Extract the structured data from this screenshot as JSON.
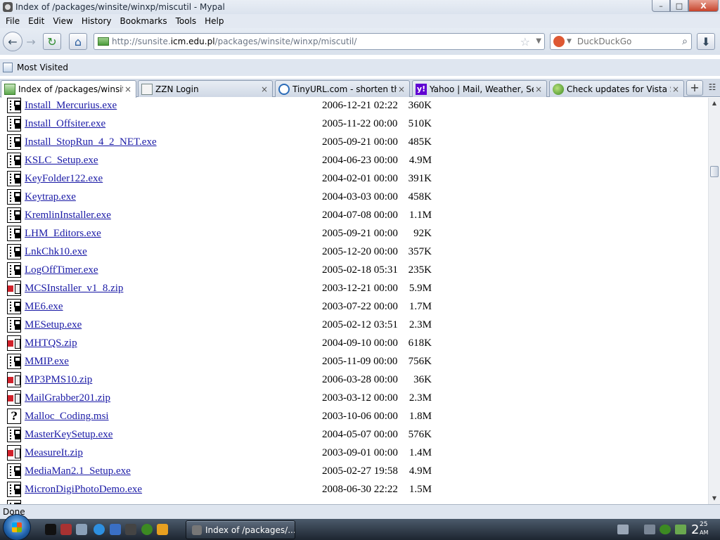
{
  "window": {
    "title": "Index of /packages/winsite/winxp/miscutil - Mypal",
    "minimize": "–",
    "maximize": "□",
    "close": "X"
  },
  "menu": [
    "File",
    "Edit",
    "View",
    "History",
    "Bookmarks",
    "Tools",
    "Help"
  ],
  "nav": {
    "back_icon": "←",
    "forward_icon": "→",
    "reload_icon": "↻",
    "home_icon": "⌂",
    "url_prefix": "http://sunsite.",
    "url_domain": "icm.edu.pl",
    "url_path": "/packages/winsite/winxp/miscutil/",
    "star_icon": "☆",
    "search_engine": "DuckDuckGo",
    "search_placeholder": "DuckDuckGo",
    "search_icon": "⌕",
    "download_icon": "⬇"
  },
  "bookmarks": {
    "most_visited": "Most Visited"
  },
  "tabs": [
    {
      "label": "Index of /packages/winsite...",
      "close": "×"
    },
    {
      "label": "ZZN Login",
      "close": "×"
    },
    {
      "label": "TinyURL.com - shorten tha...",
      "close": "×"
    },
    {
      "label": "Yahoo | Mail, Weather, Sea...",
      "close": "×",
      "icon_text": "y!"
    },
    {
      "label": "Check updates for Vista St...",
      "close": "×"
    }
  ],
  "tab_controls": {
    "new_tab": "+",
    "all_tabs": "☷"
  },
  "files": [
    {
      "name": "Install_Mercurius.exe",
      "date": "2006-12-21 02:22",
      "size": "360K",
      "type": "exe"
    },
    {
      "name": "Install_Offsiter.exe",
      "date": "2005-11-22 00:00",
      "size": "510K",
      "type": "exe"
    },
    {
      "name": "Install_StopRun_4_2_NET.exe",
      "date": "2005-09-21 00:00",
      "size": "485K",
      "type": "exe"
    },
    {
      "name": "KSLC_Setup.exe",
      "date": "2004-06-23 00:00",
      "size": "4.9M",
      "type": "exe"
    },
    {
      "name": "KeyFolder122.exe",
      "date": "2004-02-01 00:00",
      "size": "391K",
      "type": "exe"
    },
    {
      "name": "Keytrap.exe",
      "date": "2004-03-03 00:00",
      "size": "458K",
      "type": "exe"
    },
    {
      "name": "KremlinInstaller.exe",
      "date": "2004-07-08 00:00",
      "size": "1.1M",
      "type": "exe"
    },
    {
      "name": "LHM_Editors.exe",
      "date": "2005-09-21 00:00",
      "size": "92K",
      "type": "exe"
    },
    {
      "name": "LnkChk10.exe",
      "date": "2005-12-20 00:00",
      "size": "357K",
      "type": "exe"
    },
    {
      "name": "LogOffTimer.exe",
      "date": "2005-02-18 05:31",
      "size": "235K",
      "type": "exe"
    },
    {
      "name": "MCSInstaller_v1_8.zip",
      "date": "2003-12-21 00:00",
      "size": "5.9M",
      "type": "zip"
    },
    {
      "name": "ME6.exe",
      "date": "2003-07-22 00:00",
      "size": "1.7M",
      "type": "exe"
    },
    {
      "name": "MESetup.exe",
      "date": "2005-02-12 03:51",
      "size": "2.3M",
      "type": "exe"
    },
    {
      "name": "MHTQS.zip",
      "date": "2004-09-10 00:00",
      "size": "618K",
      "type": "zip"
    },
    {
      "name": "MMIP.exe",
      "date": "2005-11-09 00:00",
      "size": "756K",
      "type": "exe"
    },
    {
      "name": "MP3PMS10.zip",
      "date": "2006-03-28 00:00",
      "size": "36K",
      "type": "zip"
    },
    {
      "name": "MailGrabber201.zip",
      "date": "2003-03-12 00:00",
      "size": "2.3M",
      "type": "zip"
    },
    {
      "name": "Malloc_Coding.msi",
      "date": "2003-10-06 00:00",
      "size": "1.8M",
      "type": "msi"
    },
    {
      "name": "MasterKeySetup.exe",
      "date": "2004-05-07 00:00",
      "size": "576K",
      "type": "exe"
    },
    {
      "name": "MeasureIt.zip",
      "date": "2003-09-01 00:00",
      "size": "1.4M",
      "type": "zip"
    },
    {
      "name": "MediaMan2.1_Setup.exe",
      "date": "2005-02-27 19:58",
      "size": "4.9M",
      "type": "exe"
    },
    {
      "name": "MicronDigiPhotoDemo.exe",
      "date": "2008-06-30 22:22",
      "size": "1.5M",
      "type": "exe"
    }
  ],
  "scrollbar": {
    "up": "▲",
    "down": "▼"
  },
  "status": "Done",
  "taskbar": {
    "window_button": "Index of /packages/...",
    "clock_hour": "2",
    "clock_minute": "25",
    "clock_ampm": "AM"
  }
}
